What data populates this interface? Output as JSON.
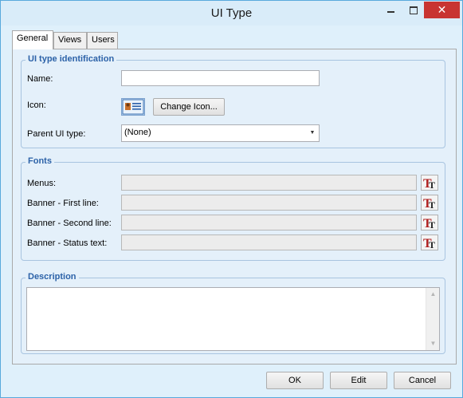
{
  "window": {
    "title": "UI Type",
    "minimize_glyph": "",
    "maximize_glyph": "",
    "close_glyph": "✕"
  },
  "tabs": [
    {
      "label": "General",
      "active": true
    },
    {
      "label": "Views",
      "active": false
    },
    {
      "label": "Users",
      "active": false
    }
  ],
  "identification": {
    "title": "UI type identification",
    "name_label": "Name:",
    "name_value": "",
    "icon_label": "Icon:",
    "change_icon_label": "Change Icon...",
    "parent_label": "Parent UI type:",
    "parent_value": "(None)"
  },
  "fonts": {
    "title": "Fonts",
    "rows": [
      {
        "label": "Menus:",
        "value": ""
      },
      {
        "label": "Banner - First line:",
        "value": ""
      },
      {
        "label": "Banner - Second line:",
        "value": ""
      },
      {
        "label": "Banner - Status text:",
        "value": ""
      }
    ]
  },
  "description": {
    "title": "Description",
    "value": ""
  },
  "buttons": {
    "ok": "OK",
    "edit": "Edit",
    "cancel": "Cancel"
  },
  "colors": {
    "titlebar": "#d9ecf9",
    "close_button": "#c83431",
    "group_title": "#2c62a8",
    "page_background": "#e4f0fa"
  }
}
